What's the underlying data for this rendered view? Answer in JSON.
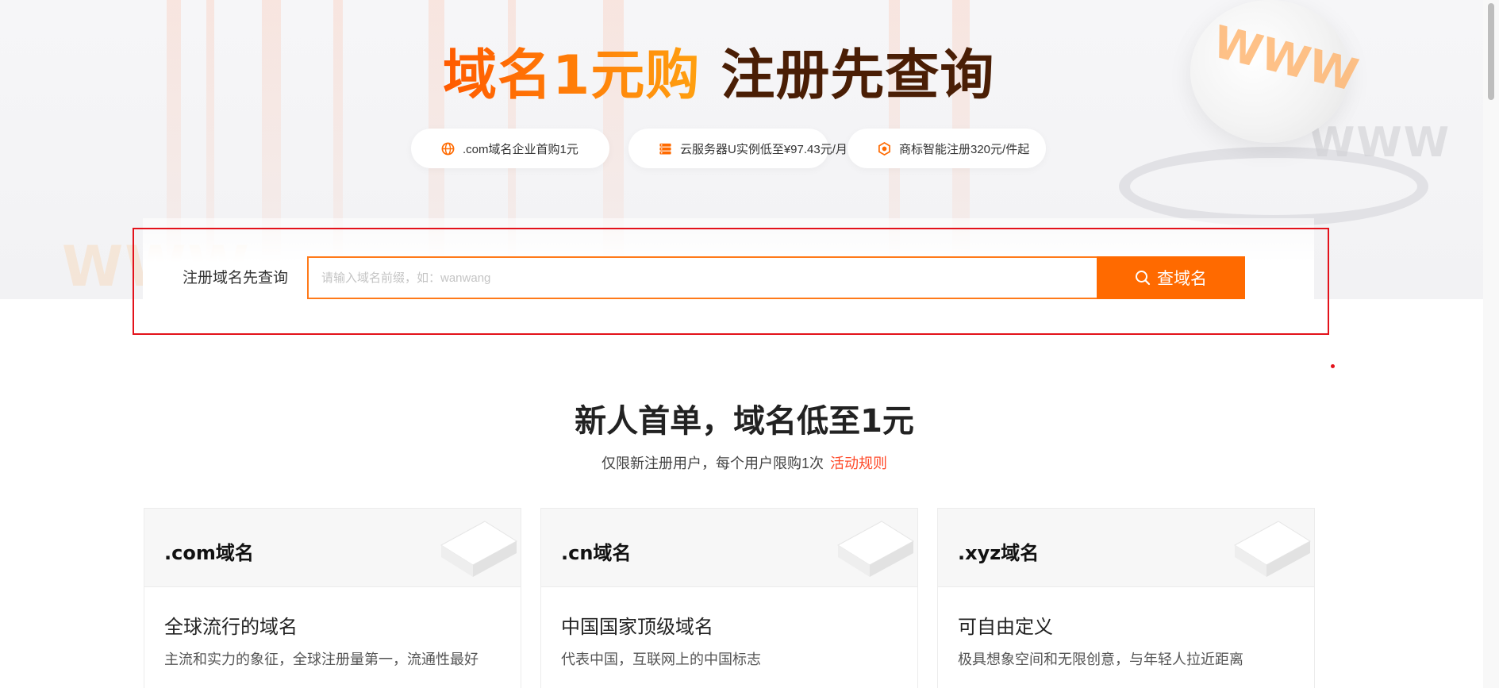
{
  "hero": {
    "headline_accent": "域名1元购",
    "headline_main": "注册先查询",
    "decor_text": "WWW"
  },
  "promos": [
    {
      "label": ".com域名企业首购1元",
      "icon": "globe-icon"
    },
    {
      "label": "云服务器U实例低至¥97.43元/月",
      "icon": "server-icon"
    },
    {
      "label": "商标智能注册320元/件起",
      "icon": "trademark-icon"
    }
  ],
  "search": {
    "label": "注册域名先查询",
    "placeholder": "请输入域名前缀，如：wanwang",
    "button_label": "查域名"
  },
  "section": {
    "title": "新人首单，域名低至1元",
    "subtitle": "仅限新注册用户，每个用户限购1次",
    "rules_link": "活动规则"
  },
  "cards": [
    {
      "title": ".com域名",
      "heading": "全球流行的域名",
      "desc": "主流和实力的象征，全球注册量第一，流通性最好"
    },
    {
      "title": ".cn域名",
      "heading": "中国国家顶级域名",
      "desc": "代表中国，互联网上的中国标志"
    },
    {
      "title": ".xyz域名",
      "heading": "可自由定义",
      "desc": "极具想象空间和无限创意，与年轻人拉近距离"
    }
  ],
  "colors": {
    "accent": "#ff6a00",
    "highlight": "#e3121b",
    "link": "#ff4a2a",
    "headline_dark": "#4a1e05"
  }
}
